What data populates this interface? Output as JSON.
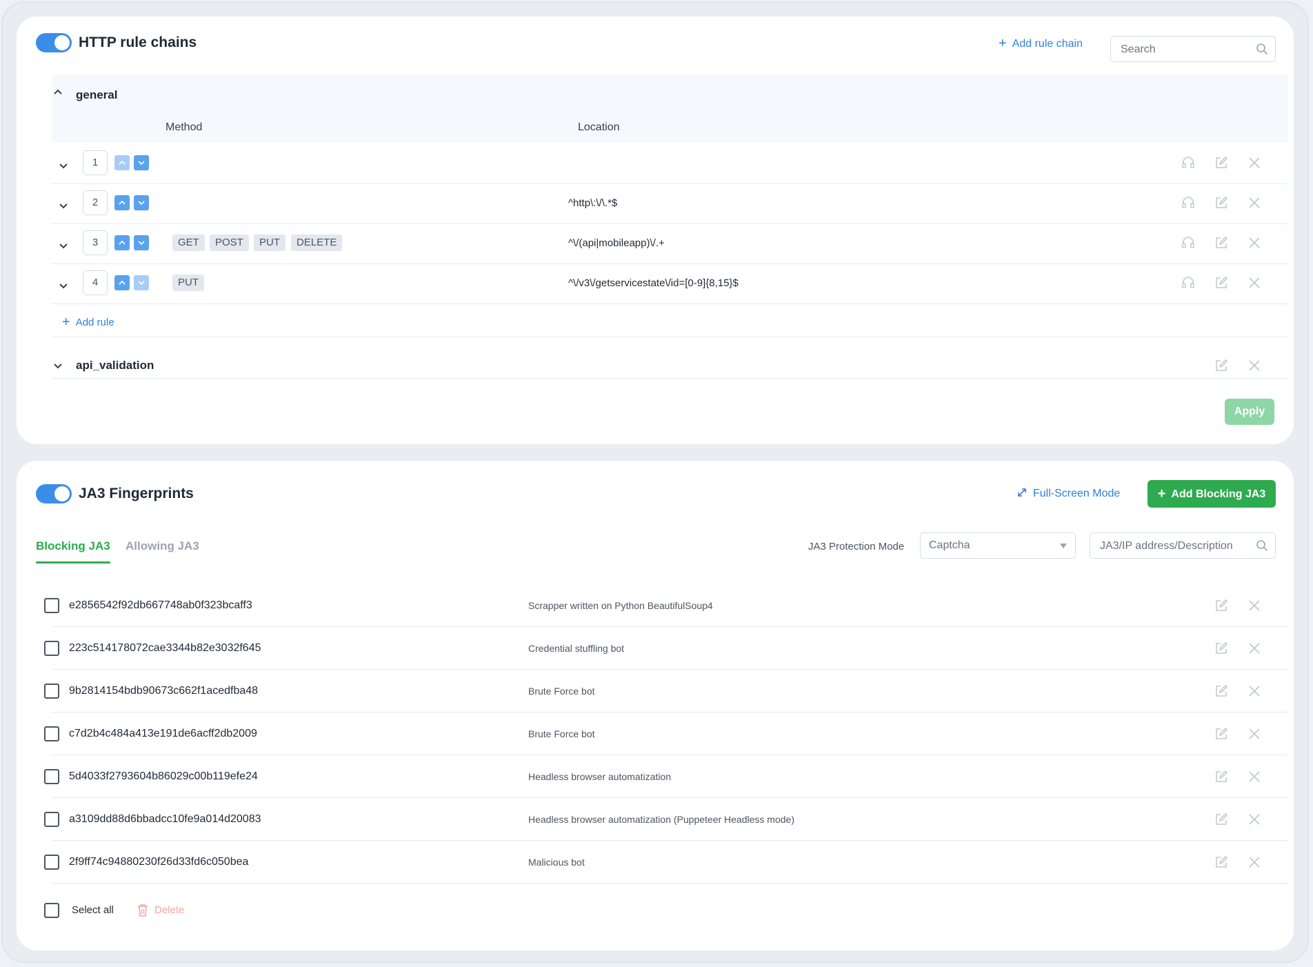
{
  "http": {
    "title": "HTTP rule chains",
    "add_chain_label": "Add rule chain",
    "search_placeholder": "Search",
    "chains": [
      {
        "name": "general",
        "expanded": true,
        "columns": [
          "Method",
          "Location"
        ],
        "rules": [
          {
            "index": "1",
            "methods": [],
            "location": ""
          },
          {
            "index": "2",
            "methods": [],
            "location": "^http\\:\\/\\.*$"
          },
          {
            "index": "3",
            "methods": [
              "GET",
              "POST",
              "PUT",
              "DELETE"
            ],
            "location": "^\\/(api|mobileapp)\\/.+"
          },
          {
            "index": "4",
            "methods": [
              "PUT"
            ],
            "location": "^\\/v3\\/getservicestate\\/id=[0-9]{8,15}$"
          }
        ],
        "add_rule_label": "Add rule"
      },
      {
        "name": "api_validation",
        "expanded": false
      }
    ],
    "apply_label": "Apply"
  },
  "ja3": {
    "title": "JA3 Fingerprints",
    "fullscreen_label": "Full-Screen Mode",
    "add_blocking_label": "Add Blocking JA3",
    "tabs": [
      {
        "label": "Blocking JA3",
        "active": true
      },
      {
        "label": "Allowing JA3",
        "active": false
      }
    ],
    "protection_mode_label": "JA3 Protection Mode",
    "protection_mode_value": "Captcha",
    "search_placeholder": "JA3/IP address/Description",
    "rows": [
      {
        "hash": "e2856542f92db667748ab0f323bcaff3",
        "description": "Scrapper written on Python BeautifulSoup4"
      },
      {
        "hash": "223c514178072cae3344b82e3032f645",
        "description": "Credential stuffling bot"
      },
      {
        "hash": "9b2814154bdb90673c662f1acedfba48",
        "description": "Brute Force bot"
      },
      {
        "hash": "c7d2b4c484a413e191de6acff2db2009",
        "description": "Brute Force bot"
      },
      {
        "hash": "5d4033f2793604b86029c00b119efe24",
        "description": "Headless browser automatization"
      },
      {
        "hash": "a3109dd88d6bbadcc10fe9a014d20083",
        "description": "Headless browser automatization (Puppeteer Headless mode)"
      },
      {
        "hash": "2f9ff74c94880230f26d33fd6c050bea",
        "description": "Malicious bot"
      }
    ],
    "select_all_label": "Select all",
    "delete_label": "Delete"
  },
  "colors": {
    "accent_blue": "#3b8ee8",
    "accent_green": "#2eaa4f",
    "apply_disabled": "#8fd6a6",
    "delete_disabled": "#f5a6a0"
  }
}
